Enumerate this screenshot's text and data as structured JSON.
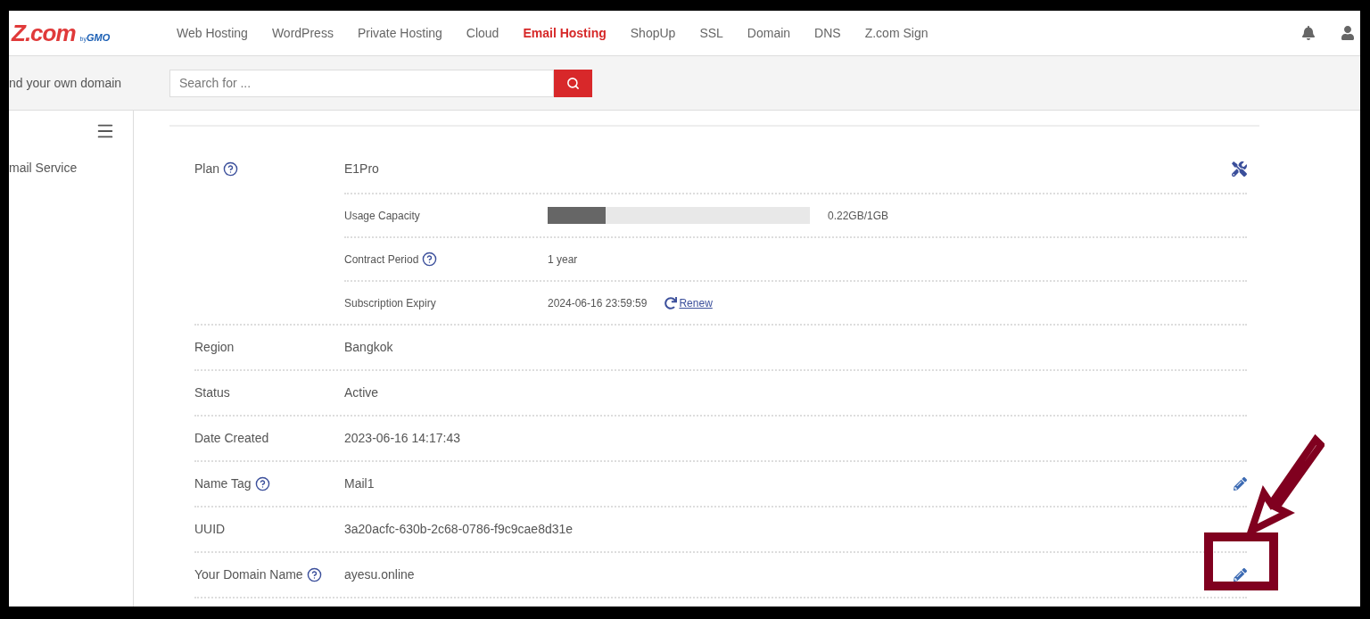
{
  "logo": {
    "main": "Z.com",
    "by": "by",
    "brand": "GMO"
  },
  "nav": [
    {
      "label": "Web Hosting",
      "selected": false
    },
    {
      "label": "WordPress",
      "selected": false
    },
    {
      "label": "Private Hosting",
      "selected": false
    },
    {
      "label": "Cloud",
      "selected": false
    },
    {
      "label": "Email Hosting",
      "selected": true
    },
    {
      "label": "ShopUp",
      "selected": false
    },
    {
      "label": "SSL",
      "selected": false
    },
    {
      "label": "Domain",
      "selected": false
    },
    {
      "label": "DNS",
      "selected": false
    },
    {
      "label": "Z.com Sign",
      "selected": false
    }
  ],
  "search": {
    "prompt": "nd your own domain",
    "placeholder": "Search for ..."
  },
  "sidebar": {
    "items": [
      "mail Service"
    ]
  },
  "rows": [
    {
      "label": "Plan",
      "help": true,
      "value": "E1Pro",
      "kind": "settings",
      "children": [
        {
          "kind": "meter",
          "label": "Usage Capacity",
          "help": false,
          "level": 0.22,
          "reading": "0.22GB/1GB"
        },
        {
          "kind": "text",
          "label": "Contract Period",
          "help": true,
          "value": "1 year"
        },
        {
          "kind": "expiry",
          "label": "Subscription Expiry",
          "help": false,
          "value": "2024-06-16 23:59:59",
          "link": "Renew"
        }
      ]
    },
    {
      "label": "Region",
      "help": false,
      "value": "Bangkok"
    },
    {
      "label": "Status",
      "help": false,
      "value": "Active"
    },
    {
      "label": "Date Created",
      "help": false,
      "value": "2023-06-16 14:17:43"
    },
    {
      "label": "Name Tag",
      "help": true,
      "value": "Mail1",
      "kind": "editable"
    },
    {
      "label": "UUID",
      "help": false,
      "value": "3a20acfc-630b-2c68-0786-f9c9cae8d31e"
    },
    {
      "label": "Your Domain Name",
      "help": true,
      "value": "ayesu.online",
      "kind": "editable"
    }
  ]
}
